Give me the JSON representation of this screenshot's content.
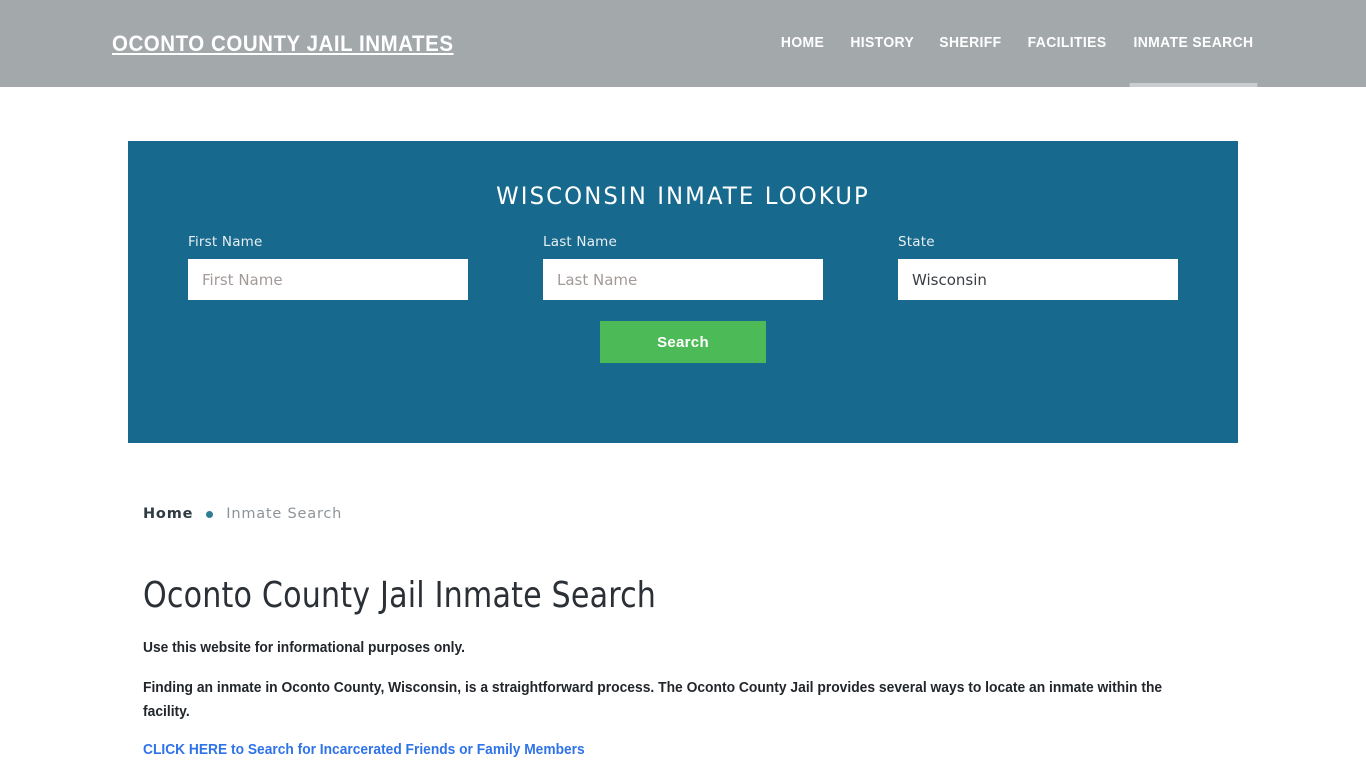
{
  "header": {
    "brand": "OCONTO COUNTY JAIL INMATES",
    "nav": [
      {
        "label": "HOME",
        "active": false
      },
      {
        "label": "HISTORY",
        "active": false
      },
      {
        "label": "SHERIFF",
        "active": false
      },
      {
        "label": "FACILITIES",
        "active": false
      },
      {
        "label": "INMATE SEARCH",
        "active": true
      }
    ],
    "background_color": "#a3a8ab"
  },
  "lookup": {
    "title": "WISCONSIN INMATE LOOKUP",
    "panel_color": "#176a8e",
    "fields": {
      "first_name": {
        "label": "First Name",
        "placeholder": "First Name",
        "value": ""
      },
      "last_name": {
        "label": "Last Name",
        "placeholder": "Last Name",
        "value": ""
      },
      "state": {
        "label": "State",
        "placeholder": "State",
        "value": "Wisconsin"
      }
    },
    "search_button": {
      "label": "Search",
      "color": "#4cba56"
    }
  },
  "breadcrumb": {
    "home": "Home",
    "separator": "•",
    "current": "Inmate Search"
  },
  "main": {
    "title": "Oconto County Jail Inmate Search",
    "lede": "Use this website for informational purposes only.",
    "paragraph": "Finding an inmate in Oconto County, Wisconsin, is a straightforward process. The Oconto County Jail provides several ways to locate an inmate within the facility.",
    "cta_link": "CLICK HERE to Search for Incarcerated Friends or Family Members",
    "link_color": "#2f73e8"
  }
}
